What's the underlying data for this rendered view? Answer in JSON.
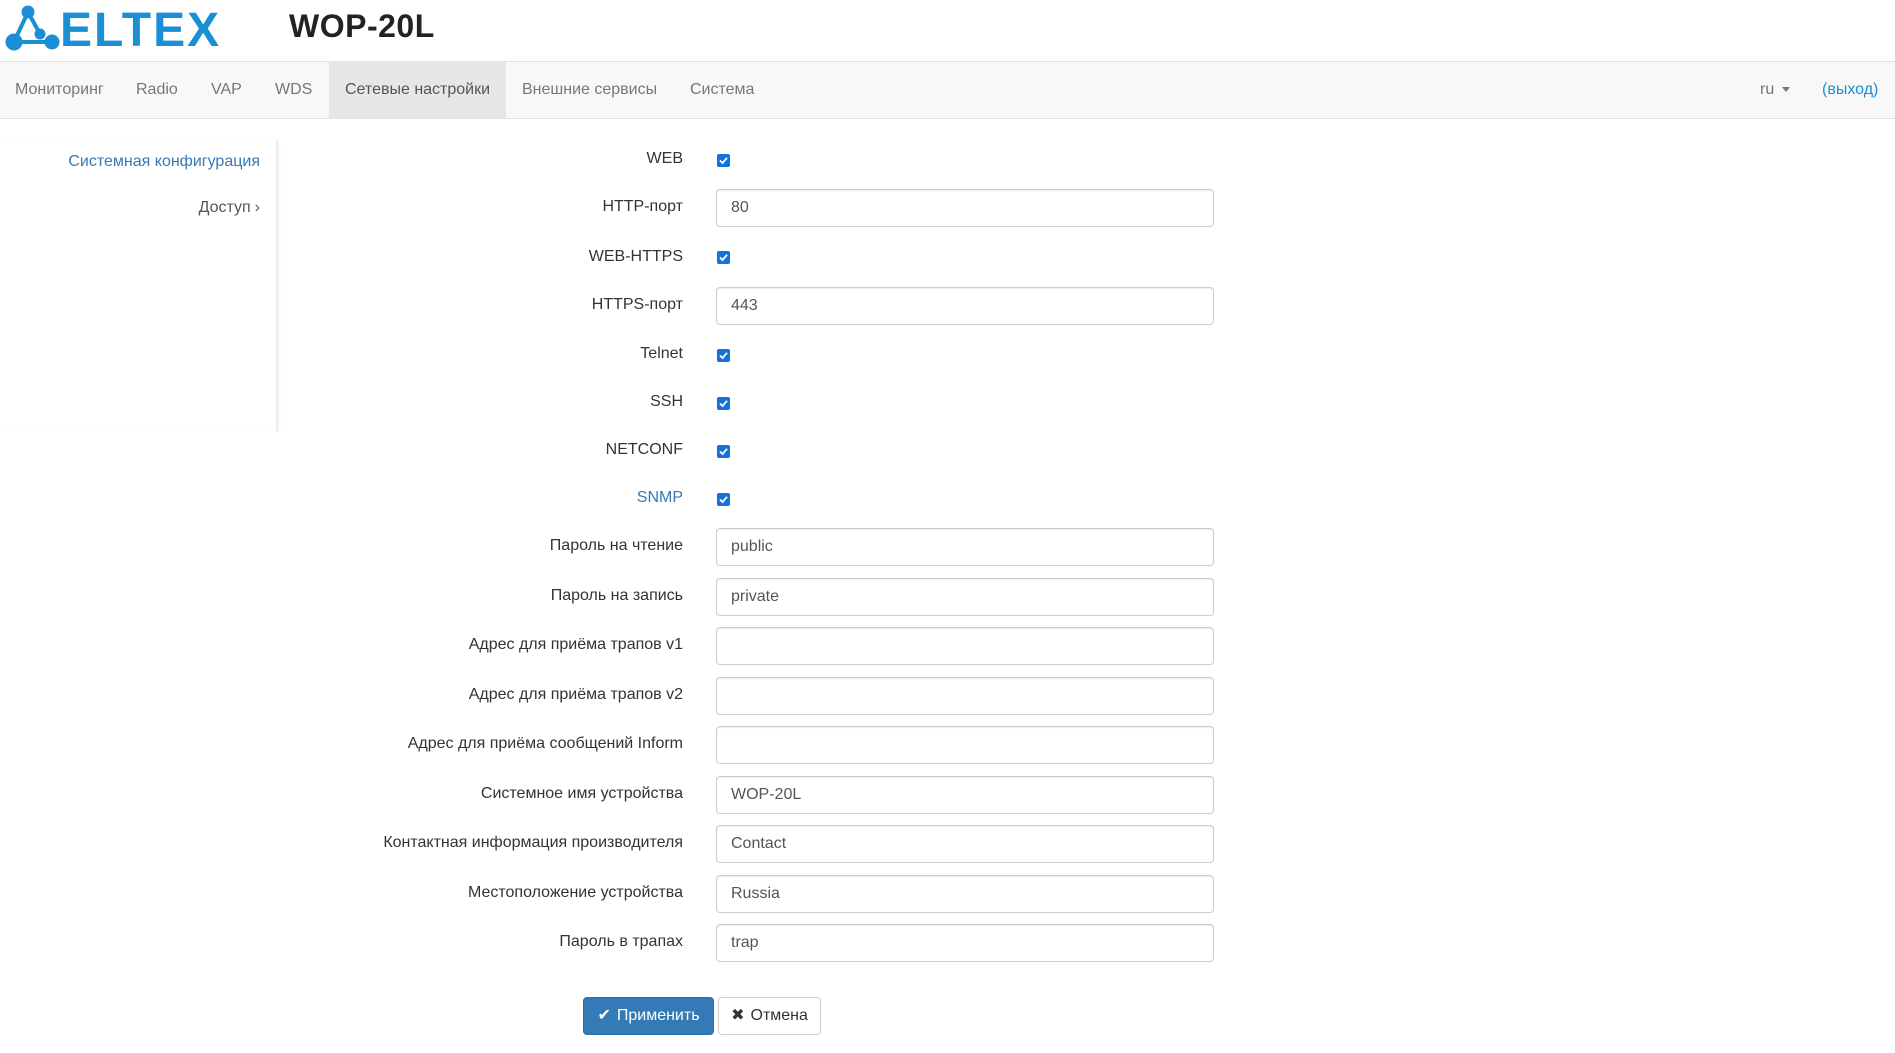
{
  "header": {
    "brand": "ELTEX",
    "device_title": "WOP-20L",
    "brand_color": "#1a8fd6"
  },
  "nav": {
    "items": [
      {
        "label": "Мониторинг"
      },
      {
        "label": "Radio"
      },
      {
        "label": "VAP"
      },
      {
        "label": "WDS"
      },
      {
        "label": "Сетевые настройки",
        "active": true
      },
      {
        "label": "Внешние сервисы"
      },
      {
        "label": "Система"
      }
    ],
    "language": "ru",
    "logout": "(выход)"
  },
  "sidebar": {
    "items": [
      {
        "label": "Системная конфигурация",
        "active": true
      },
      {
        "label": "Доступ",
        "icon": "chevron-right-icon"
      }
    ]
  },
  "form": {
    "web": {
      "label": "WEB",
      "checked": true
    },
    "http_port": {
      "label": "HTTP-порт",
      "value": "80"
    },
    "web_https": {
      "label": "WEB-HTTPS",
      "checked": true
    },
    "https_port": {
      "label": "HTTPS-порт",
      "value": "443"
    },
    "telnet": {
      "label": "Telnet",
      "checked": true
    },
    "ssh": {
      "label": "SSH",
      "checked": true
    },
    "netconf": {
      "label": "NETCONF",
      "checked": true
    },
    "snmp": {
      "label": "SNMP",
      "checked": true
    },
    "read_password": {
      "label": "Пароль на чтение",
      "value": "public"
    },
    "write_password": {
      "label": "Пароль на запись",
      "value": "private"
    },
    "trap_v1": {
      "label": "Адрес для приёма трапов v1",
      "value": ""
    },
    "trap_v2": {
      "label": "Адрес для приёма трапов v2",
      "value": ""
    },
    "inform": {
      "label": "Адрес для приёма сообщений Inform",
      "value": ""
    },
    "sys_name": {
      "label": "Системное имя устройства",
      "value": "WOP-20L"
    },
    "contact": {
      "label": "Контактная информация производителя",
      "value": "Contact"
    },
    "location": {
      "label": "Местоположение устройства",
      "value": "Russia"
    },
    "trap_password": {
      "label": "Пароль в трапах",
      "value": "trap"
    }
  },
  "buttons": {
    "apply": {
      "label": "Применить",
      "icon": "checkmark-icon"
    },
    "cancel": {
      "label": "Отмена",
      "icon": "close-icon"
    }
  },
  "colors": {
    "primary": "#337ab7",
    "checkbox": "#0f75dc",
    "link": "#337ab7"
  }
}
